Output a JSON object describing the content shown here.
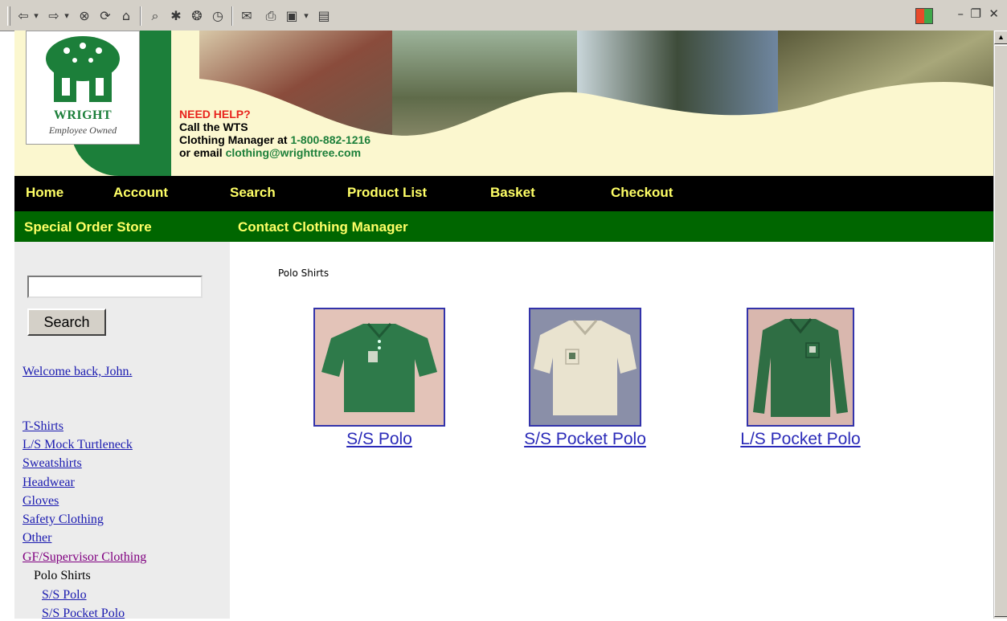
{
  "toolbar": {
    "buttons": [
      {
        "name": "back-icon",
        "glyph": "⇦"
      },
      {
        "name": "back-dropdown-icon",
        "glyph": "▾"
      },
      {
        "name": "forward-icon",
        "glyph": "⇨"
      },
      {
        "name": "forward-dropdown-icon",
        "glyph": "▾"
      },
      {
        "name": "stop-icon",
        "glyph": "⊗"
      },
      {
        "name": "refresh-icon",
        "glyph": "⟳"
      },
      {
        "name": "home-icon",
        "glyph": "⌂"
      },
      {
        "name": "search-icon",
        "glyph": "⌕"
      },
      {
        "name": "favorites-icon",
        "glyph": "✱"
      },
      {
        "name": "media-icon",
        "glyph": "❂"
      },
      {
        "name": "history-icon",
        "glyph": "◷"
      },
      {
        "name": "mail-icon",
        "glyph": "✉"
      },
      {
        "name": "print-icon",
        "glyph": "⎙"
      },
      {
        "name": "edit-icon",
        "glyph": "▣"
      },
      {
        "name": "edit-dropdown-icon",
        "glyph": "▾"
      },
      {
        "name": "discuss-icon",
        "glyph": "▤"
      }
    ],
    "window_controls": {
      "minimize": "–",
      "restore": "❐",
      "close": "✕"
    }
  },
  "header": {
    "logo_name": "WRIGHT",
    "logo_tagline": "Employee Owned",
    "help_heading": "NEED HELP?",
    "help_line1": "Call the WTS",
    "help_line2_prefix": "Clothing Manager at ",
    "help_phone": "1-800-882-1216",
    "help_line3_prefix": "or email ",
    "help_email": "clothing@wrighttree.com"
  },
  "colors": {
    "nav_bg": "#000000",
    "subnav_bg": "#006600",
    "nav_text": "#ffff66",
    "brand_green": "#1c7f3a",
    "help_red": "#e8231d"
  },
  "nav": {
    "home": "Home",
    "account": "Account",
    "search": "Search",
    "product_list": "Product List",
    "basket": "Basket",
    "checkout": "Checkout"
  },
  "subnav": {
    "special_order": "Special Order Store",
    "contact": "Contact Clothing Manager"
  },
  "sidebar": {
    "search_value": "",
    "search_button": "Search",
    "welcome": "Welcome back, John.",
    "categories": [
      "T-Shirts",
      "L/S Mock Turtleneck",
      "Sweatshirts",
      "Headwear",
      "Gloves",
      "Safety Clothing",
      "Other",
      "GF/Supervisor Clothing"
    ],
    "subcategory": "Polo Shirts",
    "sub_items": [
      "S/S Polo",
      "S/S Pocket Polo"
    ]
  },
  "main": {
    "category_title": "Polo Shirts",
    "products": [
      {
        "label": "S/S Polo",
        "shirt_color": "#2e7a4a",
        "bg_color": "#e3c3b8"
      },
      {
        "label": "S/S Pocket Polo",
        "shirt_color": "#e9e3cf",
        "bg_color": "#8a8fa8"
      },
      {
        "label": "L/S Pocket Polo",
        "shirt_color": "#2f6e44",
        "bg_color": "#d9b7ae"
      }
    ]
  }
}
